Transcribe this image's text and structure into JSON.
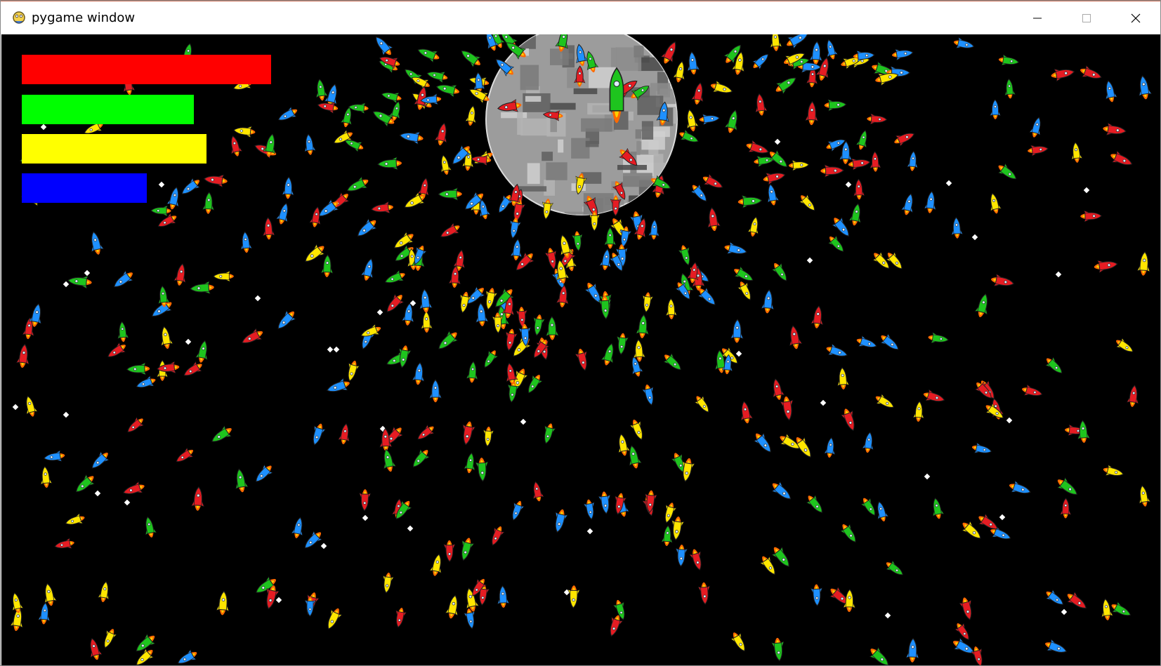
{
  "window": {
    "title": "pygame window",
    "controls": [
      "minimize",
      "maximize",
      "close"
    ]
  },
  "hud": {
    "bars": [
      {
        "color": "#ff0000",
        "level": 1.0
      },
      {
        "color": "#00ff00",
        "level": 0.69
      },
      {
        "color": "#ffff00",
        "level": 0.74
      },
      {
        "color": "#0000ff",
        "level": 0.5
      }
    ]
  },
  "scene": {
    "background": "#000000",
    "planet": "moon",
    "rocket_colors": [
      "#e51c23",
      "#1ec41e",
      "#ffe600",
      "#1e90ff"
    ],
    "flame_color": "#ff6a00",
    "star_color": "#ffffff"
  },
  "icons": {
    "app": "pygame-snake-icon",
    "minimize": "minimize-icon",
    "maximize": "maximize-icon",
    "close": "close-icon"
  }
}
